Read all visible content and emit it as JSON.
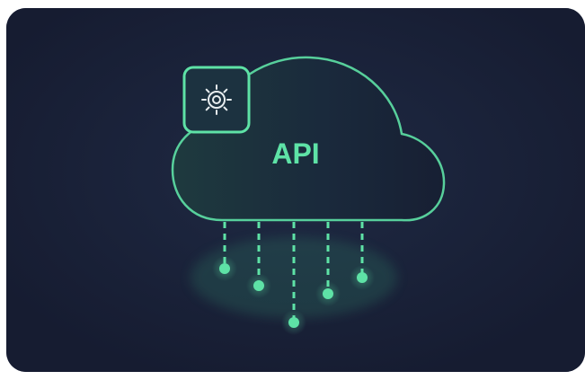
{
  "illustration": {
    "cloud_label": "API",
    "icon": "gear-icon",
    "colors": {
      "background": "#1a2138",
      "accent": "#5ee2a6",
      "cloud_fill": "#1b2a3d"
    },
    "connection_count": 5
  }
}
